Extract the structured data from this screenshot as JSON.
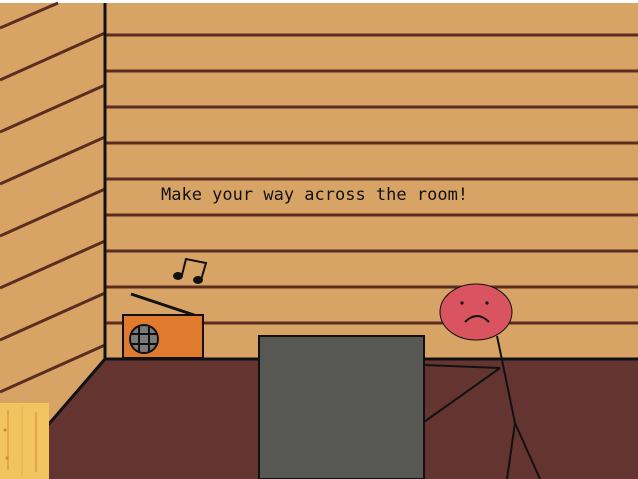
{
  "game": {
    "instruction": "Make your way across the room!"
  },
  "scene": {
    "colors": {
      "wall": "#d8a466",
      "wall_lines": "#5a2d20",
      "floor": "#643530",
      "outline": "#111111",
      "table": "#575754",
      "radio_body": "#e07a2c",
      "door_wood": "#f1c460",
      "character_face": "#d9545e"
    },
    "objects": [
      "radio",
      "music-note",
      "table",
      "stick-figure-character",
      "wooden-door"
    ],
    "character_mood": "sad"
  }
}
